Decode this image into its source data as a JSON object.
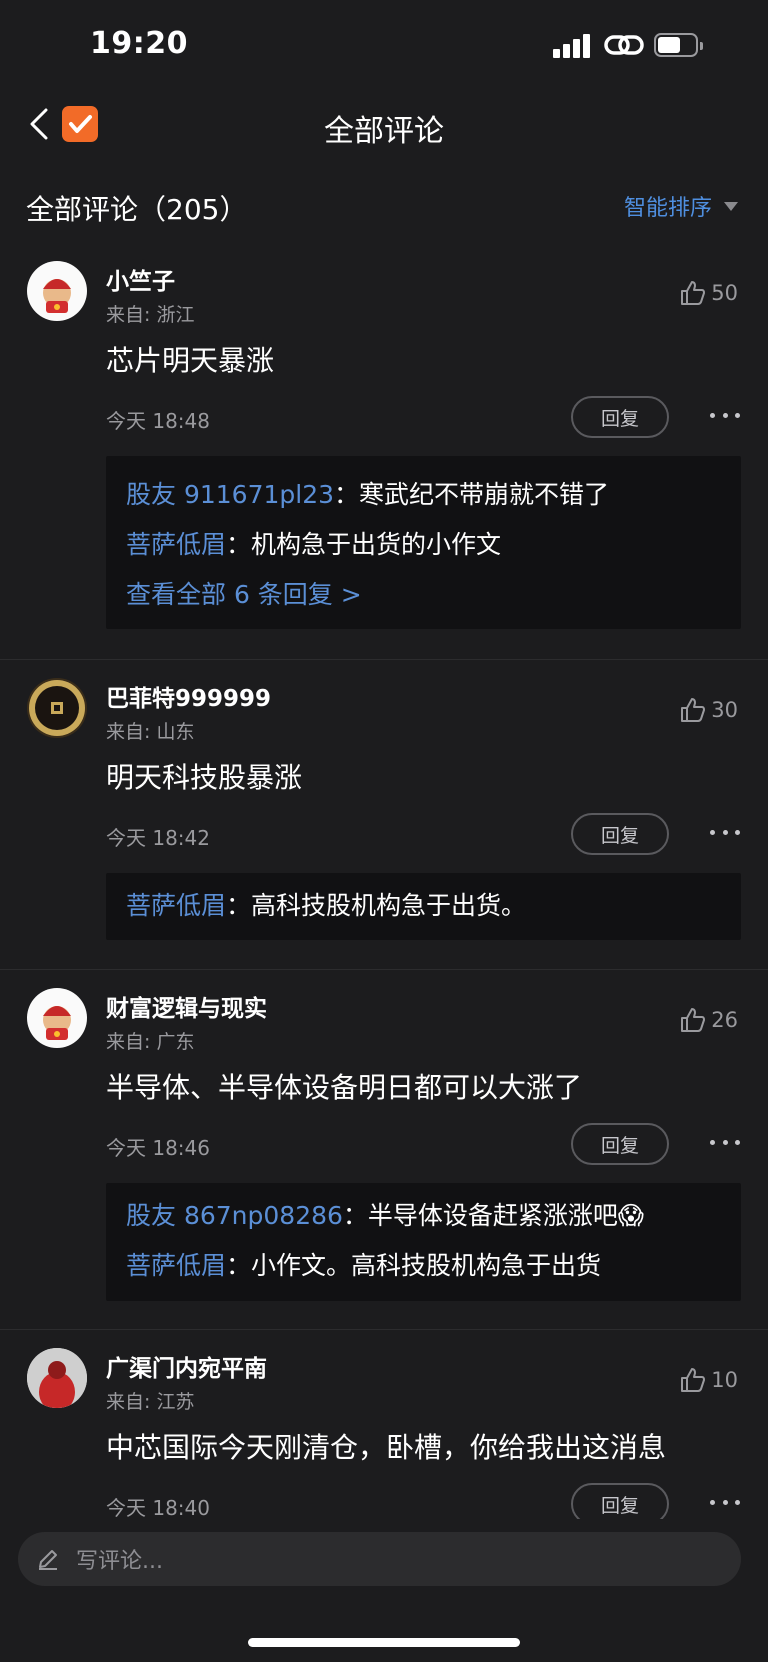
{
  "status_bar": {
    "time": "19:20",
    "battery_level": 0.62
  },
  "nav": {
    "title": "全部评论",
    "back_icon": "chevron-left-icon",
    "logo_icon": "app-logo-checkmark-icon"
  },
  "list_header": {
    "title": "全部评论（205）",
    "sort_label": "智能排序"
  },
  "comments": [
    {
      "user": "小竺子",
      "location": "来自: 浙江",
      "likes": "50",
      "text": "芯片明天暴涨",
      "time": "今天 18:48",
      "reply_label": "回复",
      "replies": [
        {
          "name": "股友 911671pl23",
          "text": "：寒武纪不带崩就不错了"
        },
        {
          "name": "菩萨低眉",
          "text": "：机构急于出货的小作文"
        }
      ],
      "view_all": "查看全部 6 条回复 >"
    },
    {
      "user": "巴菲特999999",
      "location": "来自: 山东",
      "likes": "30",
      "text": "明天科技股暴涨",
      "time": "今天 18:42",
      "reply_label": "回复",
      "replies": [
        {
          "name": "菩萨低眉",
          "text": "：高科技股机构急于出货。"
        }
      ]
    },
    {
      "user": "财富逻辑与现实",
      "location": "来自: 广东",
      "likes": "26",
      "text": "半导体、半导体设备明日都可以大涨了",
      "time": "今天 18:46",
      "reply_label": "回复",
      "replies": [
        {
          "name": "股友 867np08286",
          "text": "：半导体设备赶紧涨涨吧😱"
        },
        {
          "name": "菩萨低眉",
          "text": "：小作文。高科技股机构急于出货"
        }
      ]
    },
    {
      "user": "广渠门内宛平南",
      "location": "来自: 江苏",
      "likes": "10",
      "text": "中芯国际今天刚清仓，卧槽，你给我出这消息",
      "time": "今天 18:40",
      "reply_label": "回复",
      "replies": []
    }
  ],
  "input": {
    "placeholder": "写评论..."
  },
  "colors": {
    "background": "#1c1c1e",
    "accent": "#4f8fe0",
    "reply_name": "#5b8fd6",
    "logo": "#f26b28"
  }
}
